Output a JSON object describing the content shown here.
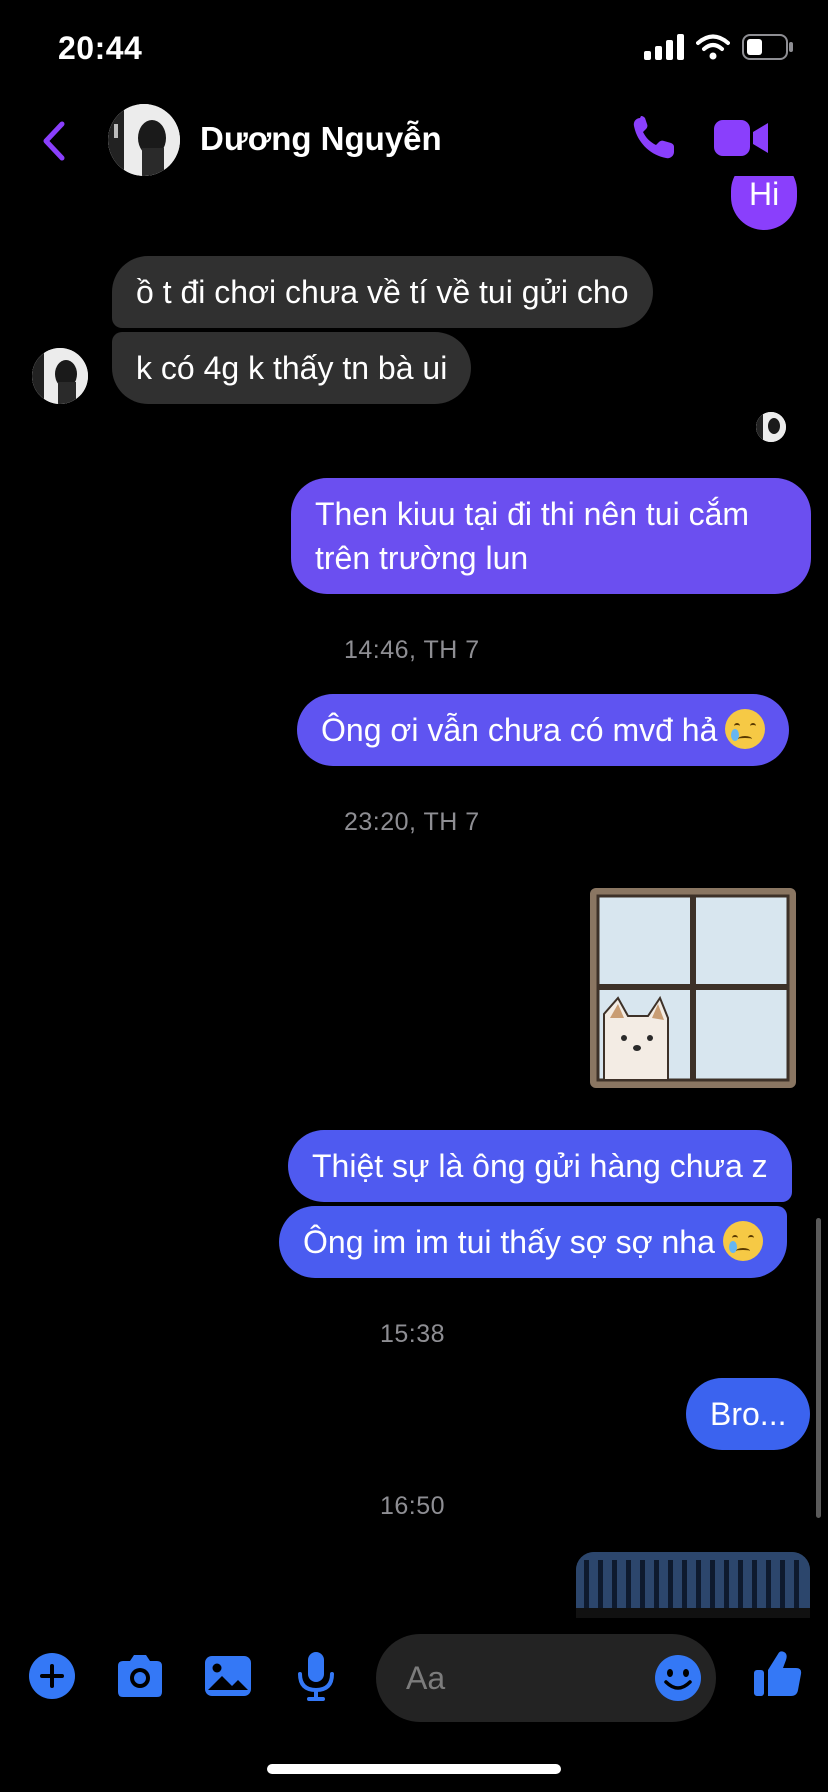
{
  "status": {
    "time": "20:44"
  },
  "header": {
    "contact_name": "Dương Nguyễn"
  },
  "messages": {
    "hi": "Hi",
    "in1": "ồ t đi chơi chưa về tí về tui gửi cho",
    "in2": "k có 4g k thấy tn bà ui",
    "out1_line1": "Then kiuu tại đi thi nên tui cắm",
    "out1_line2": "trên trường lun",
    "ts1": "14:46, TH 7",
    "out2": "Ông ơi vẫn chưa có mvđ hả",
    "ts2": "23:20, TH 7",
    "out3": "Thiệt sự là ông gửi hàng chưa z",
    "out4": "Ông im im tui thấy sợ sợ nha",
    "ts3": "15:38",
    "out5": "Bro...",
    "ts4": "16:50"
  },
  "composer": {
    "placeholder": "Aa"
  },
  "colors": {
    "accent": "#8a3ffc",
    "bubble_purple": "#6b4ff0",
    "bubble_blue": "#4c5bf0",
    "incoming": "#303030",
    "toolbar_blue": "#3478f6"
  },
  "icons": [
    "back-chevron-icon",
    "phone-icon",
    "video-camera-icon",
    "plus-icon",
    "camera-icon",
    "image-icon",
    "microphone-icon",
    "smiley-icon",
    "thumbs-up-icon",
    "cellular-signal-icon",
    "wifi-icon",
    "battery-icon"
  ]
}
